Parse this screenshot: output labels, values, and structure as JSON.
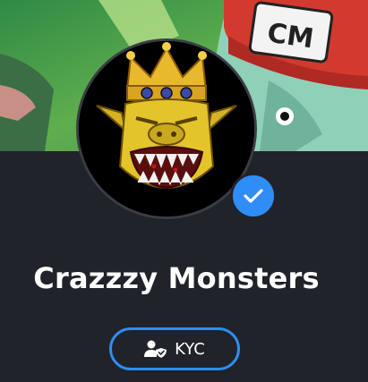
{
  "banner": {
    "cap_text": "CM"
  },
  "profile": {
    "name": "Crazzzy Monsters",
    "verified": true
  },
  "kyc_button": {
    "label": "KYC"
  },
  "colors": {
    "background": "#202329",
    "accent": "#2f8df8",
    "text": "#ffffff"
  },
  "icons": {
    "badge": "checkmark-icon",
    "kyc": "user-shield-icon"
  }
}
